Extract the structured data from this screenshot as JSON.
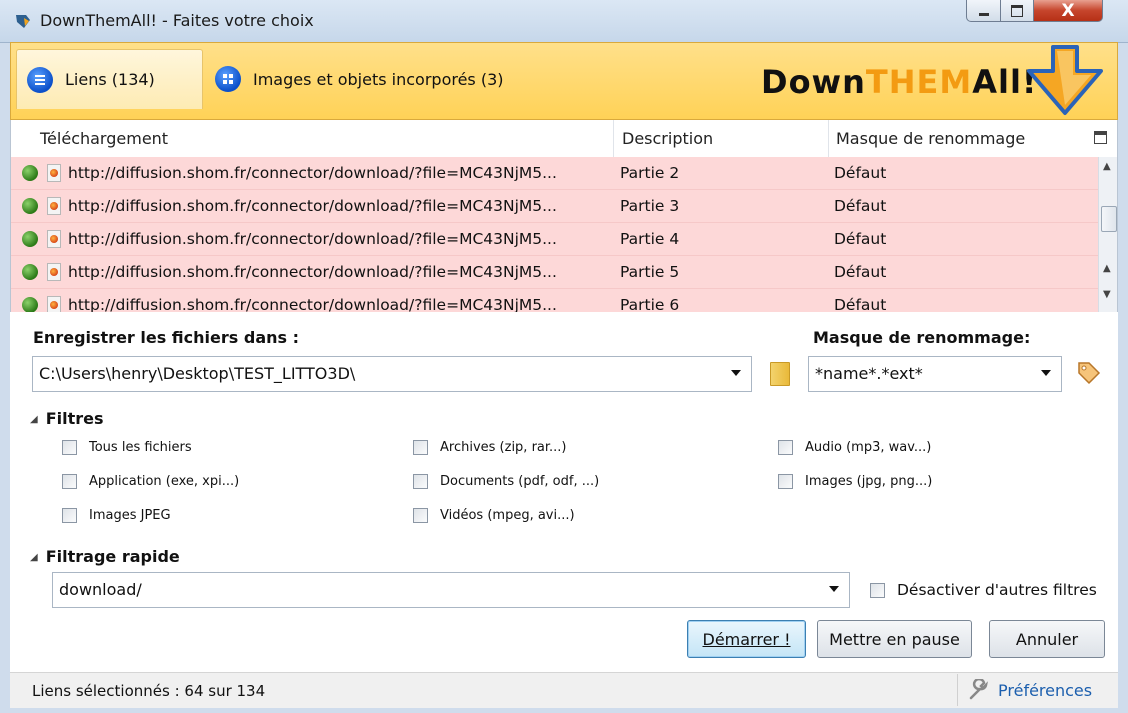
{
  "window": {
    "title": "DownThemAll! - Faites votre choix",
    "controls": {
      "minimize": "minimize-icon",
      "maximize": "maximize-icon",
      "close": "X"
    }
  },
  "tabs": [
    {
      "label": "Liens (134)",
      "icon": "list-icon",
      "active": true
    },
    {
      "label": "Images et objets incorporés (3)",
      "icon": "grid-icon",
      "active": false
    }
  ],
  "brand": {
    "part1": "Down",
    "part2": "THEM",
    "part3": "All!",
    "colors": {
      "dark": "#111111",
      "orange": "#f39b12"
    }
  },
  "table": {
    "columns": {
      "download": "Téléchargement",
      "description": "Description",
      "mask": "Masque de renommage"
    },
    "rows": [
      {
        "url": "http://diffusion.shom.fr/connector/download/?file=MC43NjM5...",
        "description": "Partie 2",
        "mask": "Défaut"
      },
      {
        "url": "http://diffusion.shom.fr/connector/download/?file=MC43NjM5...",
        "description": "Partie 3",
        "mask": "Défaut"
      },
      {
        "url": "http://diffusion.shom.fr/connector/download/?file=MC43NjM5...",
        "description": "Partie 4",
        "mask": "Défaut"
      },
      {
        "url": "http://diffusion.shom.fr/connector/download/?file=MC43NjM5...",
        "description": "Partie 5",
        "mask": "Défaut"
      },
      {
        "url": "http://diffusion.shom.fr/connector/download/?file=MC43NjM5...",
        "description": "Partie 6",
        "mask": "Défaut"
      }
    ],
    "row_color": "#fdd8d8"
  },
  "save": {
    "label": "Enregistrer les fichiers dans :",
    "path": "C:\\Users\\henry\\Desktop\\TEST_LITTO3D\\",
    "mask_label": "Masque de renommage:",
    "mask_value": "*name*.*ext*"
  },
  "filters": {
    "title": "Filtres",
    "items": [
      {
        "label": "Tous les fichiers",
        "checked": false
      },
      {
        "label": "Archives (zip, rar...)",
        "checked": false
      },
      {
        "label": "Audio (mp3, wav...)",
        "checked": false
      },
      {
        "label": "Application (exe, xpi...)",
        "checked": false
      },
      {
        "label": "Documents (pdf, odf, ...)",
        "checked": false
      },
      {
        "label": "Images (jpg, png...)",
        "checked": false
      },
      {
        "label": "Images JPEG",
        "checked": false
      },
      {
        "label": "Vidéos (mpeg, avi...)",
        "checked": false
      }
    ]
  },
  "quick_filter": {
    "title": "Filtrage rapide",
    "value": "download/",
    "disable_others_label": "Désactiver d'autres filtres"
  },
  "buttons": {
    "start": "Démarrer !",
    "pause": "Mettre en pause",
    "cancel": "Annuler"
  },
  "status": {
    "text": "Liens sélectionnés : 64 sur 134",
    "preferences": "Préférences"
  }
}
